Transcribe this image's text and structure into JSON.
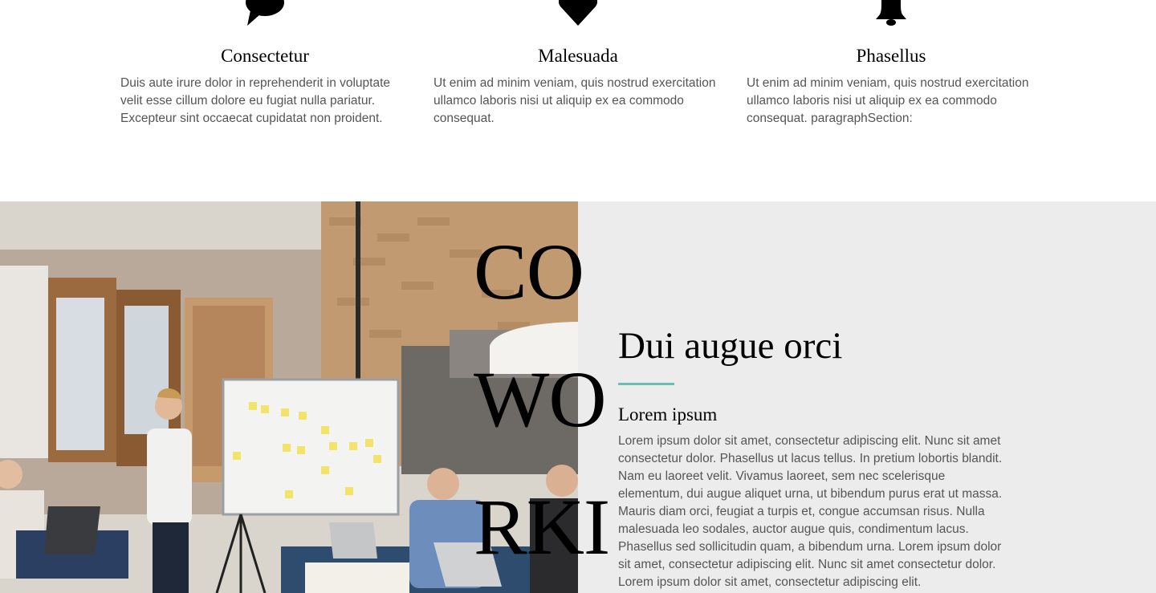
{
  "features": [
    {
      "icon": "speech-bubble-icon",
      "title": "Consectetur",
      "text": "Duis aute irure dolor in reprehenderit in voluptate velit esse cillum dolore eu fugiat nulla pariatur. Excepteur sint occaecat cupidatat non proident."
    },
    {
      "icon": "heart-icon",
      "title": "Malesuada",
      "text": "Ut enim ad minim veniam, quis nostrud exercitation ullamco laboris nisi ut aliquip ex ea commodo consequat."
    },
    {
      "icon": "bell-icon",
      "title": "Phasellus",
      "text": "Ut enim ad minim veniam, quis nostrud exercitation ullamco laboris nisi ut aliquip ex ea commodo consequat. paragraphSection:"
    }
  ],
  "cowork": {
    "big_word_lines": [
      "CO",
      "WO",
      "RKI"
    ],
    "heading": "Dui augue orci",
    "subheading": "Lorem ipsum",
    "accent_color": "#6bbfb0",
    "background_color": "#ececec",
    "body": "Lorem ipsum dolor sit amet, consectetur adipiscing elit. Nunc sit amet consectetur dolor. Phasellus ut lacus tellus. In pretium lobortis blandit. Nam eu laoreet velit. Vivamus laoreet, sem nec scelerisque elementum, dui augue aliquet urna, ut bibendum purus erat ut massa. Mauris diam orci, feugiat a turpis et, congue accumsan risus. Nulla malesuada leo sodales, auctor augue quis, condimentum lacus. Phasellus sed sollicitudin quam, a bibendum urna. Lorem ipsum dolor sit amet, consectetur adipiscing elit. Nunc sit amet consectetur dolor. Lorem ipsum dolor sit amet, consectetur adipiscing elit."
  }
}
